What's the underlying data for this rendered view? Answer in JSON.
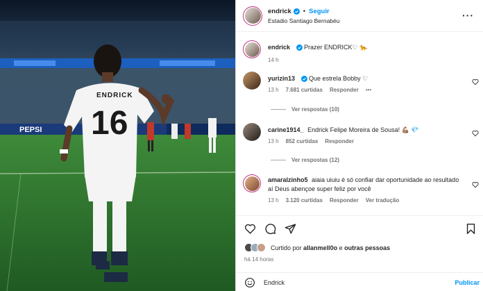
{
  "post": {
    "username": "endrick",
    "follow_label": "Seguir",
    "separator": "•",
    "location": "Estadio Santiago Bernabéu",
    "caption_username": "endrick",
    "caption": "Prazer ENDRICK♡ 🐆",
    "caption_time": "14 h",
    "jersey_name": "ENDRICK",
    "jersey_number": "16",
    "ad_board": "PEPSI"
  },
  "comments": [
    {
      "username": "yurizin13",
      "text": "Que estrela Bobby ♡",
      "time": "13 h",
      "likes": "7.681 curtidas",
      "reply": "Responder",
      "more": "•••",
      "view_replies": "Ver respostas (10)"
    },
    {
      "username": "carine1914_",
      "text": "Endrick Felipe Moreira de Sousa! 💪🏽 💎",
      "time": "13 h",
      "likes": "852 curtidas",
      "reply": "Responder",
      "view_replies": "Ver respostas (12)"
    },
    {
      "username": "amaralzinho5",
      "text": "aiaia uiuiu é só confiar dar oportunidade ao resultado aí Deus abençoe super feliz por você",
      "time": "13 h",
      "likes": "3.120 curtidas",
      "reply": "Responder",
      "translate": "Ver tradução"
    }
  ],
  "footer": {
    "liked_prefix": "Curtido por",
    "liked_user": "allanmell0o",
    "liked_conj": "e",
    "liked_others": "outras pessoas",
    "post_time": "há 14 horas",
    "composer_value": "Endrick",
    "publish_label": "Publicar"
  },
  "colors": {
    "link": "#0095f6",
    "verified": "#0095f6",
    "muted": "#737373"
  }
}
